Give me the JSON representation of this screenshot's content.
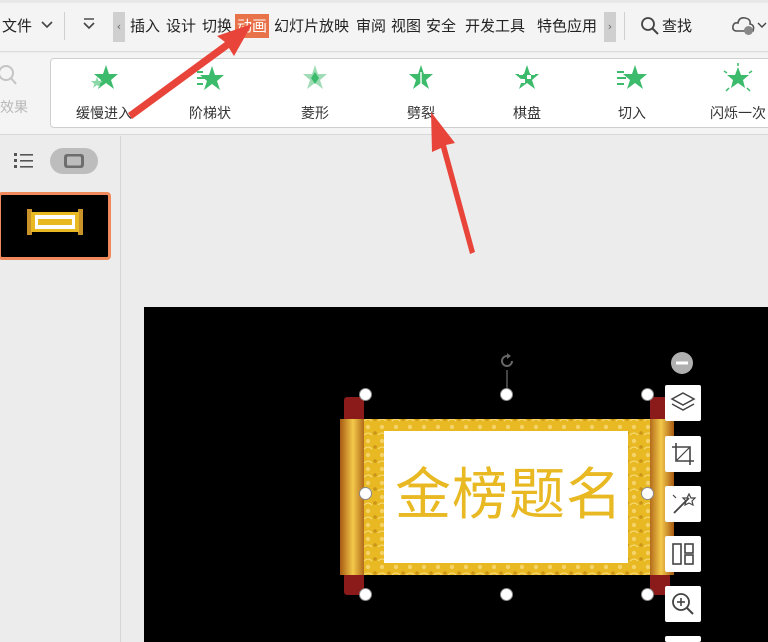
{
  "menubar": {
    "file_label": "文件",
    "tabs": [
      "插入",
      "设计",
      "切换",
      "动画",
      "幻灯片放映",
      "审阅",
      "视图",
      "安全",
      "开发工具",
      "特色应用"
    ],
    "active_tab": "动画",
    "search_label": "查找"
  },
  "ribbon": {
    "effect_label": "效果",
    "animations": [
      "缓慢进入",
      "阶梯状",
      "菱形",
      "劈裂",
      "棋盘",
      "切入",
      "闪烁一次"
    ]
  },
  "slide": {
    "scroll_text": "金榜题名"
  },
  "colors": {
    "accent": "#e8734a",
    "annotation_arrow": "#e8443a",
    "star_green": "#3dbb6c",
    "scroll_gold": "#e8b923"
  }
}
